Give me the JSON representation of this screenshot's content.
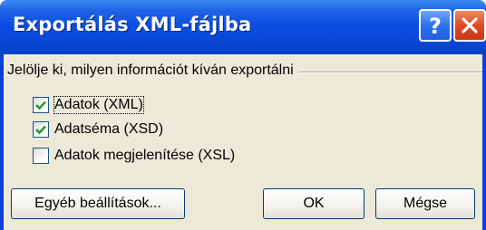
{
  "window": {
    "title": "Exportálás XML-fájlba",
    "help_icon": "question-mark-icon",
    "close_icon": "close-x-icon"
  },
  "group": {
    "label": "Jelölje ki, milyen információt kíván exportálni"
  },
  "options": [
    {
      "label": "Adatok (XML)",
      "checked": true,
      "focused": true
    },
    {
      "label": "Adatséma (XSD)",
      "checked": true,
      "focused": false
    },
    {
      "label": "Adatok megjelenítése (XSL)",
      "checked": false,
      "focused": false
    }
  ],
  "buttons": {
    "other_settings": "Egyéb beállítások...",
    "ok": "OK",
    "cancel": "Mégse"
  },
  "colors": {
    "titlebar": "#0a4fe2",
    "dialog_bg": "#ece9d8",
    "checkmark": "#21a121",
    "close_btn": "#e04a22"
  }
}
